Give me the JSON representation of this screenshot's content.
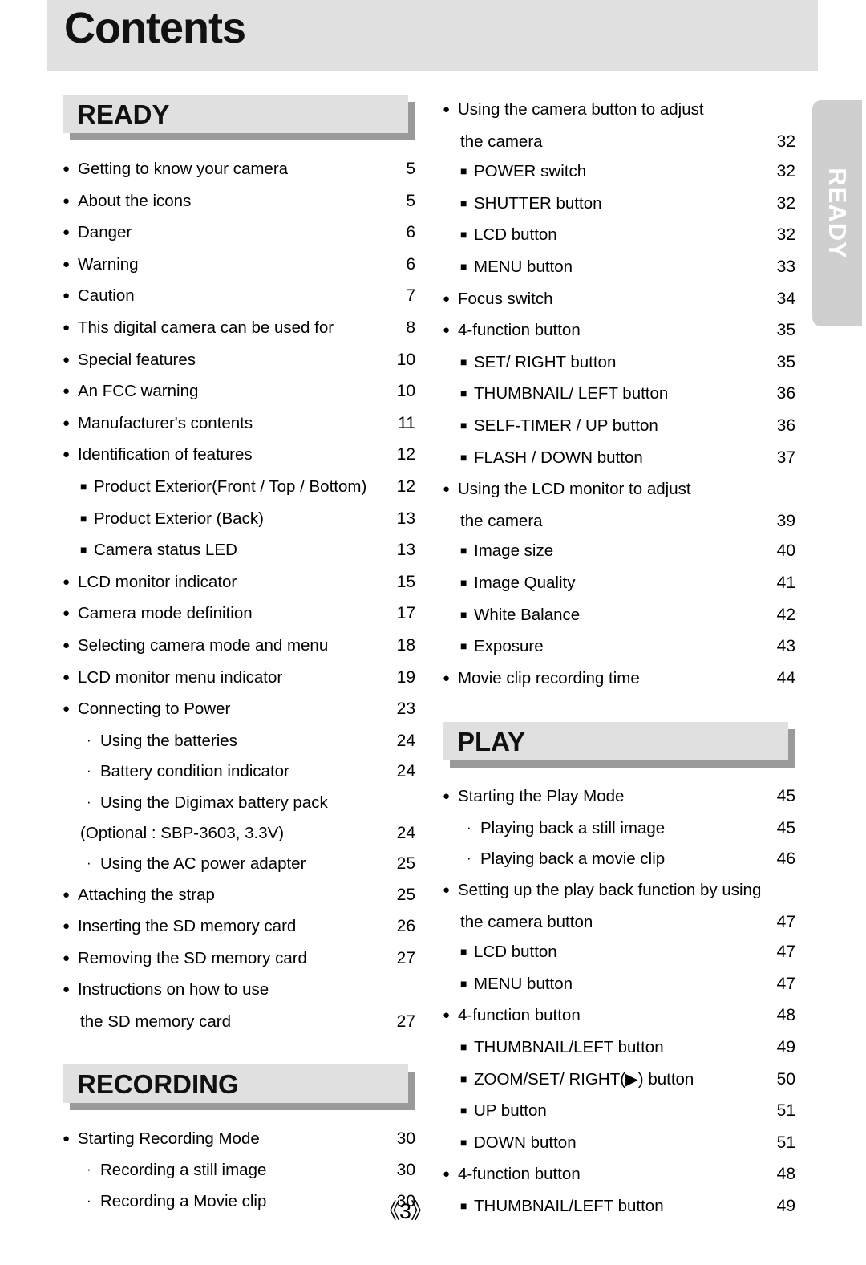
{
  "page": {
    "title": "Contents",
    "page_number": "《3》"
  },
  "side_tab": {
    "label": "READY"
  },
  "bullets": {
    "level1": "●",
    "level2": "■",
    "level3": "·"
  },
  "left_column": {
    "sections": [
      {
        "heading": "READY",
        "entries": [
          {
            "level": 1,
            "text": "Getting to know your camera",
            "page": "5"
          },
          {
            "level": 1,
            "text": "About the icons",
            "page": "5"
          },
          {
            "level": 1,
            "text": "Danger",
            "page": "6"
          },
          {
            "level": 1,
            "text": "Warning",
            "page": "6"
          },
          {
            "level": 1,
            "text": "Caution",
            "page": "7"
          },
          {
            "level": 1,
            "text": "This digital camera can be used for",
            "page": "8"
          },
          {
            "level": 1,
            "text": "Special features",
            "page": "10"
          },
          {
            "level": 1,
            "text": "An FCC warning",
            "page": "10"
          },
          {
            "level": 1,
            "text": "Manufacturer's contents",
            "page": "11"
          },
          {
            "level": 1,
            "text": "Identification of features",
            "page": "12"
          },
          {
            "level": 2,
            "text": "Product Exterior(Front / Top / Bottom)",
            "page": "12"
          },
          {
            "level": 2,
            "text": "Product Exterior (Back)",
            "page": "13"
          },
          {
            "level": 2,
            "text": "Camera status LED",
            "page": "13"
          },
          {
            "level": 1,
            "text": "LCD monitor indicator",
            "page": "15"
          },
          {
            "level": 1,
            "text": "Camera mode definition",
            "page": "17"
          },
          {
            "level": 1,
            "text": "Selecting camera mode and menu",
            "page": "18"
          },
          {
            "level": 1,
            "text": "LCD monitor menu indicator",
            "page": "19"
          },
          {
            "level": 1,
            "text": "Connecting to Power",
            "page": "23"
          },
          {
            "level": 3,
            "text": "Using the batteries",
            "page": "24"
          },
          {
            "level": 3,
            "text": "Battery condition indicator",
            "page": "24"
          },
          {
            "level": 3,
            "text": "Using the Digimax battery pack",
            "page": ""
          },
          {
            "level": 0,
            "text": "(Optional : SBP-3603, 3.3V)",
            "page": "24"
          },
          {
            "level": 3,
            "text": "Using the AC power adapter",
            "page": "25"
          },
          {
            "level": 1,
            "text": "Attaching the strap",
            "page": "25"
          },
          {
            "level": 1,
            "text": "Inserting the SD memory card",
            "page": "26"
          },
          {
            "level": 1,
            "text": "Removing the SD memory card",
            "page": "27"
          },
          {
            "level": 1,
            "text": "Instructions on how to use",
            "page": ""
          },
          {
            "level": 0,
            "text": "the SD memory card",
            "page": "27"
          }
        ]
      },
      {
        "heading": "RECORDING",
        "entries": [
          {
            "level": 1,
            "text": "Starting Recording Mode",
            "page": "30"
          },
          {
            "level": 3,
            "text": "Recording a still image",
            "page": "30"
          },
          {
            "level": 3,
            "text": "Recording a Movie clip",
            "page": "30"
          }
        ]
      }
    ]
  },
  "right_column": {
    "sections": [
      {
        "heading": "",
        "entries": [
          {
            "level": 1,
            "text": "Using the camera button to adjust",
            "page": ""
          },
          {
            "level": 0,
            "text": "the camera",
            "page": "32"
          },
          {
            "level": 2,
            "text": "POWER switch",
            "page": "32"
          },
          {
            "level": 2,
            "text": "SHUTTER button",
            "page": "32"
          },
          {
            "level": 2,
            "text": "LCD button",
            "page": "32"
          },
          {
            "level": 2,
            "text": "MENU button",
            "page": "33"
          },
          {
            "level": 1,
            "text": "Focus switch",
            "page": "34"
          },
          {
            "level": 1,
            "text": "4-function button",
            "page": "35"
          },
          {
            "level": 2,
            "text": "SET/ RIGHT button",
            "page": "35"
          },
          {
            "level": 2,
            "text": "THUMBNAIL/ LEFT button",
            "page": "36"
          },
          {
            "level": 2,
            "text": "SELF-TIMER / UP button",
            "page": "36"
          },
          {
            "level": 2,
            "text": "FLASH / DOWN button",
            "page": "37"
          },
          {
            "level": 1,
            "text": "Using the LCD monitor to adjust",
            "page": ""
          },
          {
            "level": 0,
            "text": "the camera",
            "page": "39"
          },
          {
            "level": 2,
            "text": "Image size",
            "page": "40"
          },
          {
            "level": 2,
            "text": "Image Quality",
            "page": "41"
          },
          {
            "level": 2,
            "text": "White Balance",
            "page": "42"
          },
          {
            "level": 2,
            "text": "Exposure",
            "page": "43"
          },
          {
            "level": 1,
            "text": "Movie clip recording time",
            "page": "44"
          }
        ]
      },
      {
        "heading": "PLAY",
        "entries": [
          {
            "level": 1,
            "text": "Starting the Play Mode",
            "page": "45"
          },
          {
            "level": 3,
            "text": "Playing back a still image",
            "page": "45"
          },
          {
            "level": 3,
            "text": "Playing back a movie clip",
            "page": "46"
          },
          {
            "level": 1,
            "text": "Setting up the play back function by using",
            "page": ""
          },
          {
            "level": 0,
            "text": "the camera button",
            "page": "47"
          },
          {
            "level": 2,
            "text": "LCD button",
            "page": "47"
          },
          {
            "level": 2,
            "text": "MENU button",
            "page": "47"
          },
          {
            "level": 1,
            "text": "4-function button",
            "page": "48"
          },
          {
            "level": 2,
            "text": "THUMBNAIL/LEFT button",
            "page": "49"
          },
          {
            "level": 2,
            "text": "ZOOM/SET/ RIGHT(▶) button",
            "page": "50"
          },
          {
            "level": 2,
            "text": "UP  button",
            "page": "51"
          },
          {
            "level": 2,
            "text": "DOWN button",
            "page": "51"
          },
          {
            "level": 1,
            "text": "4-function button",
            "page": "48"
          },
          {
            "level": 2,
            "text": "THUMBNAIL/LEFT button",
            "page": "49"
          }
        ]
      }
    ]
  }
}
